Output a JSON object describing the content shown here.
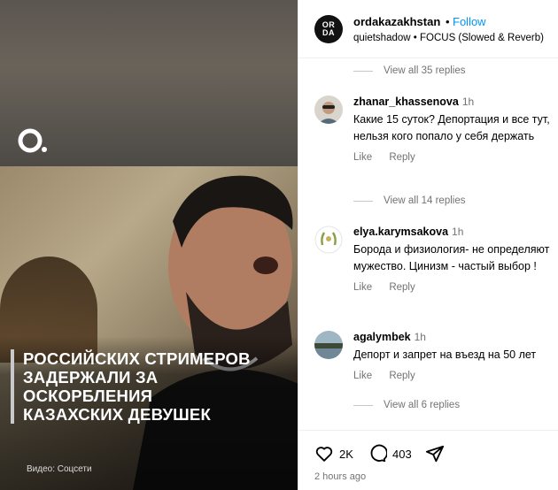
{
  "media": {
    "headline_lines": [
      "Российских стримеров",
      "задержали за оскорбления",
      "казахских девушек"
    ],
    "credit": "Видео: Соцсети"
  },
  "header": {
    "account": "ordakazakhstan",
    "avatar_text_line1": "OR",
    "avatar_text_line2": "DA",
    "separator": "•",
    "follow_label": "Follow",
    "music": "quietshadow • FOCUS (Slowed & Reverb)"
  },
  "thread": {
    "view_replies_1": "View all 35 replies",
    "view_replies_2": "View all 14 replies",
    "view_replies_3": "View all 6 replies",
    "comments": [
      {
        "username": "zhanar_khassenova",
        "time": "1h",
        "text": "Какие 15 суток? Депортация и все тут, нельзя кого попало у себя держать",
        "like_label": "Like",
        "reply_label": "Reply"
      },
      {
        "username": "elya.karymsakova",
        "time": "1h",
        "text": "Борода и физиология- не определяют мужество. Цинизм - частый выбор !",
        "like_label": "Like",
        "reply_label": "Reply"
      },
      {
        "username": "agalymbek",
        "time": "1h",
        "text": "Депорт и запрет на въезд на 50 лет",
        "like_label": "Like",
        "reply_label": "Reply"
      }
    ]
  },
  "footer": {
    "likes": "2K",
    "comments": "403",
    "posted": "2 hours ago"
  },
  "colors": {
    "accent": "#0095f6",
    "muted": "#737373"
  }
}
